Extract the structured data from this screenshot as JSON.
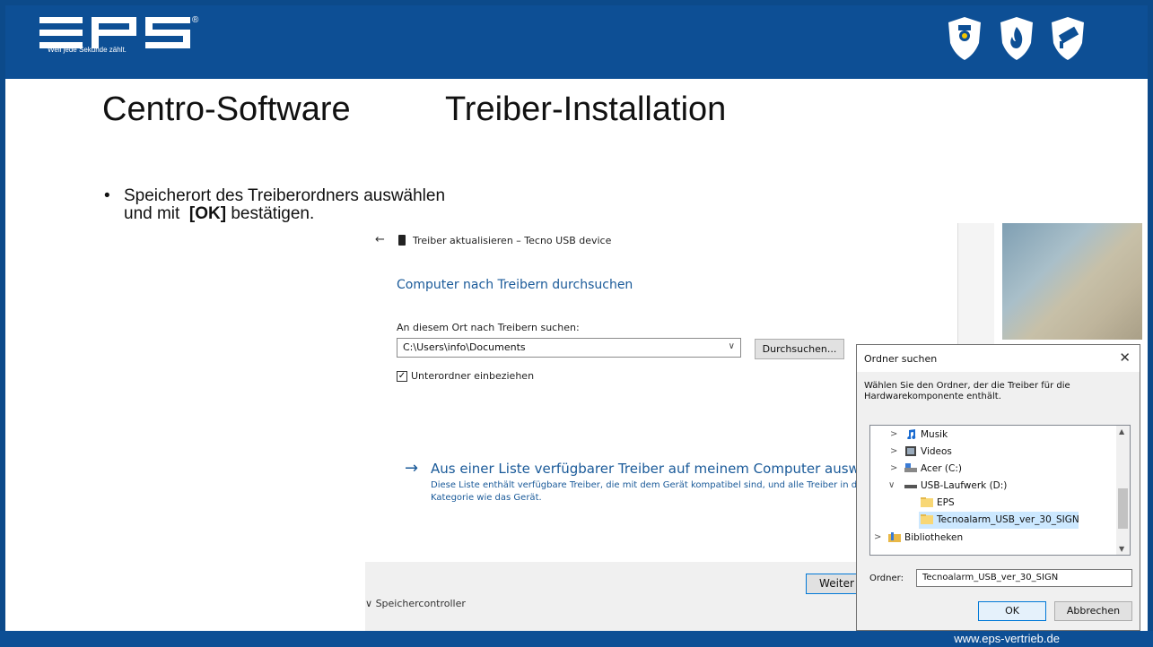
{
  "header": {
    "logo_text": "EPS",
    "logo_registered": "®",
    "tagline": "Weil jede Sekunde zählt.",
    "icons": [
      "security-camera-shield-icon",
      "fire-shield-icon",
      "camera-shield-icon"
    ],
    "colors": {
      "brand_blue": "#0d4f95",
      "white": "#ffffff"
    }
  },
  "slide": {
    "title_left": "Centro-Software",
    "title_right": "Treiber-Installation",
    "bullet": {
      "marker": "•",
      "line1": "Speicherort des Treiberordners auswählen",
      "line2_pre": "und mit",
      "line2_bold": "[OK]",
      "line2_post": "bestätigen."
    }
  },
  "driver_window": {
    "back": "←",
    "title": "Treiber aktualisieren – Tecno USB device",
    "heading": "Computer nach Treibern durchsuchen",
    "location_label": "An diesem Ort nach Treibern suchen:",
    "path_value": "C:\\Users\\info\\Documents",
    "browse_button": "Durchsuchen...",
    "subfolders_checked": true,
    "subfolders_label": "Unterordner einbeziehen",
    "link_arrow": "→",
    "link": "Aus einer Liste verfügbarer Treiber auf meinem Computer auswählen",
    "desc_line1": "Diese Liste enthält verfügbare Treiber, die mit dem Gerät kompatibel sind, und alle Treiber in d",
    "desc_line2": "Kategorie wie das Gerät.",
    "next_button": "Weiter",
    "background_fragment": "Speichercontroller"
  },
  "folder_dialog": {
    "title": "Ordner suchen",
    "close": "✕",
    "description": "Wählen Sie den Ordner, der die Treiber für die Hardwarekomponente enthält.",
    "tree": [
      {
        "label": "Musik",
        "expander": ">",
        "icon": "music-icon"
      },
      {
        "label": "Videos",
        "expander": ">",
        "icon": "video-icon"
      },
      {
        "label": "Acer (C:)",
        "expander": ">",
        "icon": "drive-icon"
      },
      {
        "label": "USB-Laufwerk (D:)",
        "expander": "∨",
        "icon": "usb-drive-icon"
      },
      {
        "label": "EPS",
        "expander": "",
        "icon": "folder-icon"
      },
      {
        "label": "Tecnoalarm_USB_ver_30_SIGN",
        "expander": "",
        "icon": "folder-icon",
        "selected": true
      },
      {
        "label": "Bibliotheken",
        "expander": ">",
        "icon": "library-icon"
      }
    ],
    "folder_label": "Ordner:",
    "folder_value": "Tecnoalarm_USB_ver_30_SIGN",
    "ok_button": "OK",
    "cancel_button": "Abbrechen"
  },
  "footer": {
    "url": "www.eps-vertrieb.de"
  }
}
